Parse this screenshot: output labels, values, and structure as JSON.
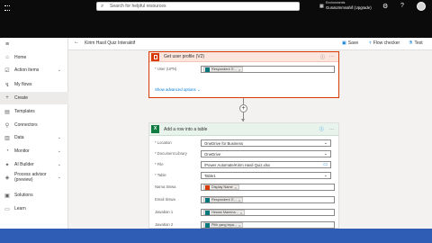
{
  "header": {
    "search_placeholder": "Search for helpful resources",
    "environments_label": "Environments",
    "environment_name": "GunaUmmnahif (Upgrade)"
  },
  "sidebar": {
    "items": [
      {
        "label": "Home",
        "icon": "home-icon"
      },
      {
        "label": "Action items",
        "icon": "checklist-icon",
        "expand": true
      },
      {
        "label": "My flows",
        "icon": "flows-icon"
      },
      {
        "label": "Create",
        "icon": "plus-icon",
        "selected": true
      },
      {
        "label": "Templates",
        "icon": "templates-icon"
      },
      {
        "label": "Connectors",
        "icon": "connectors-icon"
      },
      {
        "label": "Data",
        "icon": "data-icon",
        "expand": true
      },
      {
        "label": "Monitor",
        "icon": "monitor-icon",
        "expand": true
      },
      {
        "label": "AI Builder",
        "icon": "ai-builder-icon",
        "expand": true
      },
      {
        "label": "Process advisor (preview)",
        "icon": "process-advisor-icon",
        "expand": true
      },
      {
        "label": "Solutions",
        "icon": "solutions-icon"
      },
      {
        "label": "Learn",
        "icon": "learn-icon"
      }
    ]
  },
  "commandbar": {
    "flow_title": "Kirim Hasil Quiz Interaktif",
    "save": "Save",
    "flow_checker": "Flow checker",
    "test": "Test"
  },
  "card1": {
    "title": "Get user profile (V2)",
    "field_label": "User (UPN)",
    "token": "Responders' E...",
    "show_advanced": "Show advanced options"
  },
  "card2": {
    "title": "Add a row into a table",
    "fields": [
      {
        "label": "* Location",
        "value": "OneDrive for Business",
        "type": "dropdown"
      },
      {
        "label": "* Document Library",
        "value": "OneDrive",
        "type": "dropdown"
      },
      {
        "label": "* File",
        "value": "/Power Automate/Kirim Hasil Quiz.xlsx",
        "type": "file"
      },
      {
        "label": "* Table",
        "value": "Table1",
        "type": "dropdown"
      },
      {
        "label": "Nama Siswa",
        "token": "Display Name",
        "token_icon": "office-icon"
      },
      {
        "label": "Email Siswa",
        "token": "Responders' E...",
        "token_icon": "forms-icon"
      },
      {
        "label": "Jawaban 1",
        "token": "Hewan Mamma...",
        "token_icon": "forms-icon"
      },
      {
        "label": "Jawaban 2",
        "token": "Pilih yang tepa...",
        "token_icon": "forms-icon"
      },
      {
        "label": "Nilai 1",
        "token": "",
        "token_icon": ""
      }
    ]
  },
  "colors": {
    "office_red": "#d83b01",
    "excel_green": "#107c41",
    "forms_teal": "#03787c",
    "accent_blue": "#0078d4"
  }
}
